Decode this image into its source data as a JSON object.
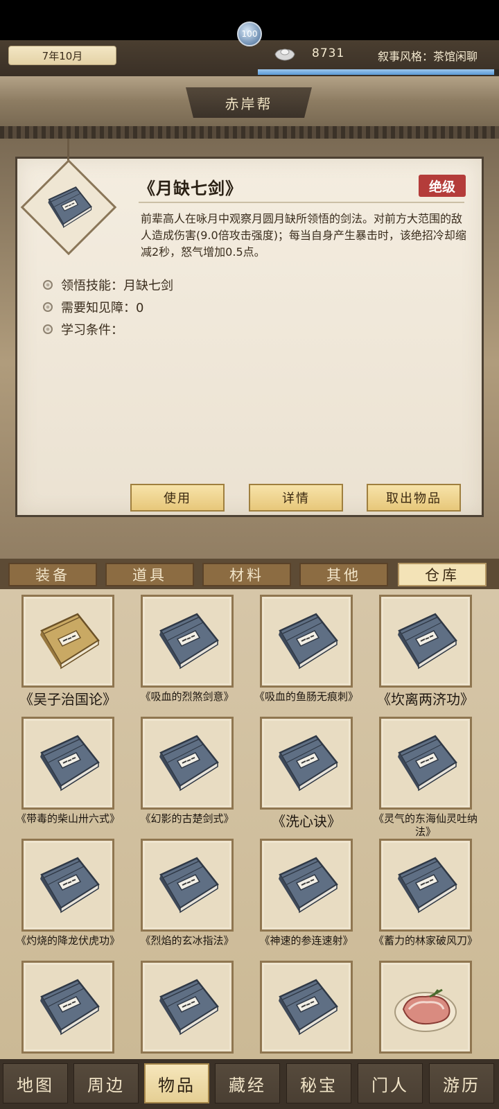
{
  "header": {
    "date": "7年10月",
    "silver_amount": "8731",
    "narrative_style": "叙事风格：茶馆闲聊",
    "level": "100",
    "exp_progress": 0.98,
    "silver_icon": "silver-ingot-icon"
  },
  "sect": {
    "title": "赤岸帮"
  },
  "detail": {
    "title": "《月缺七剑》",
    "grade": "绝级",
    "grade_color": "#b43c3a",
    "description": "前辈高人在咏月中观察月圆月缺所领悟的剑法。对前方大范围的敌人造成伤害(9.0倍攻击强度)；每当自身产生暴击时，该绝招冷却缩减2秒，怒气增加0.5点。",
    "attributes": [
      {
        "label": "领悟技能：月缺七剑"
      },
      {
        "label": "需要知见障：0"
      },
      {
        "label": "学习条件："
      }
    ],
    "buttons": {
      "use": "使用",
      "details": "详情",
      "take_out": "取出物品"
    }
  },
  "categories": [
    {
      "label": "装备"
    },
    {
      "label": "道具"
    },
    {
      "label": "材料"
    },
    {
      "label": "其他"
    },
    {
      "label": "仓库",
      "active": true
    }
  ],
  "inventory": [
    {
      "name": "《吴子治国论》",
      "icon": "tan-manual-icon"
    },
    {
      "name": "《吸血的烈煞剑意》",
      "icon": "manual-book-icon"
    },
    {
      "name": "《吸血的鱼肠无痕刺》",
      "icon": "manual-book-icon"
    },
    {
      "name": "《坎离两济功》",
      "icon": "manual-book-icon"
    },
    {
      "name": "《带毒的柴山卅六式》",
      "icon": "manual-book-icon"
    },
    {
      "name": "《幻影的古楚剑式》",
      "icon": "manual-book-icon"
    },
    {
      "name": "《洗心诀》",
      "icon": "manual-book-icon"
    },
    {
      "name": "《灵气的东海仙灵吐纳法》",
      "icon": "manual-book-icon"
    },
    {
      "name": "《灼烧的降龙伏虎功》",
      "icon": "manual-book-icon"
    },
    {
      "name": "《烈焰的玄冰指法》",
      "icon": "manual-book-icon"
    },
    {
      "name": "《神速的参连速射》",
      "icon": "manual-book-icon"
    },
    {
      "name": "《蓄力的林家破风刀》",
      "icon": "manual-book-icon"
    },
    {
      "name": "",
      "icon": "manual-book-icon"
    },
    {
      "name": "",
      "icon": "manual-book-icon"
    },
    {
      "name": "",
      "icon": "manual-book-icon"
    },
    {
      "name": "",
      "icon": "meat-plate-icon"
    }
  ],
  "nav": [
    {
      "label": "地图"
    },
    {
      "label": "周边"
    },
    {
      "label": "物品",
      "active": true
    },
    {
      "label": "藏经"
    },
    {
      "label": "秘宝"
    },
    {
      "label": "门人"
    },
    {
      "label": "游历"
    }
  ]
}
